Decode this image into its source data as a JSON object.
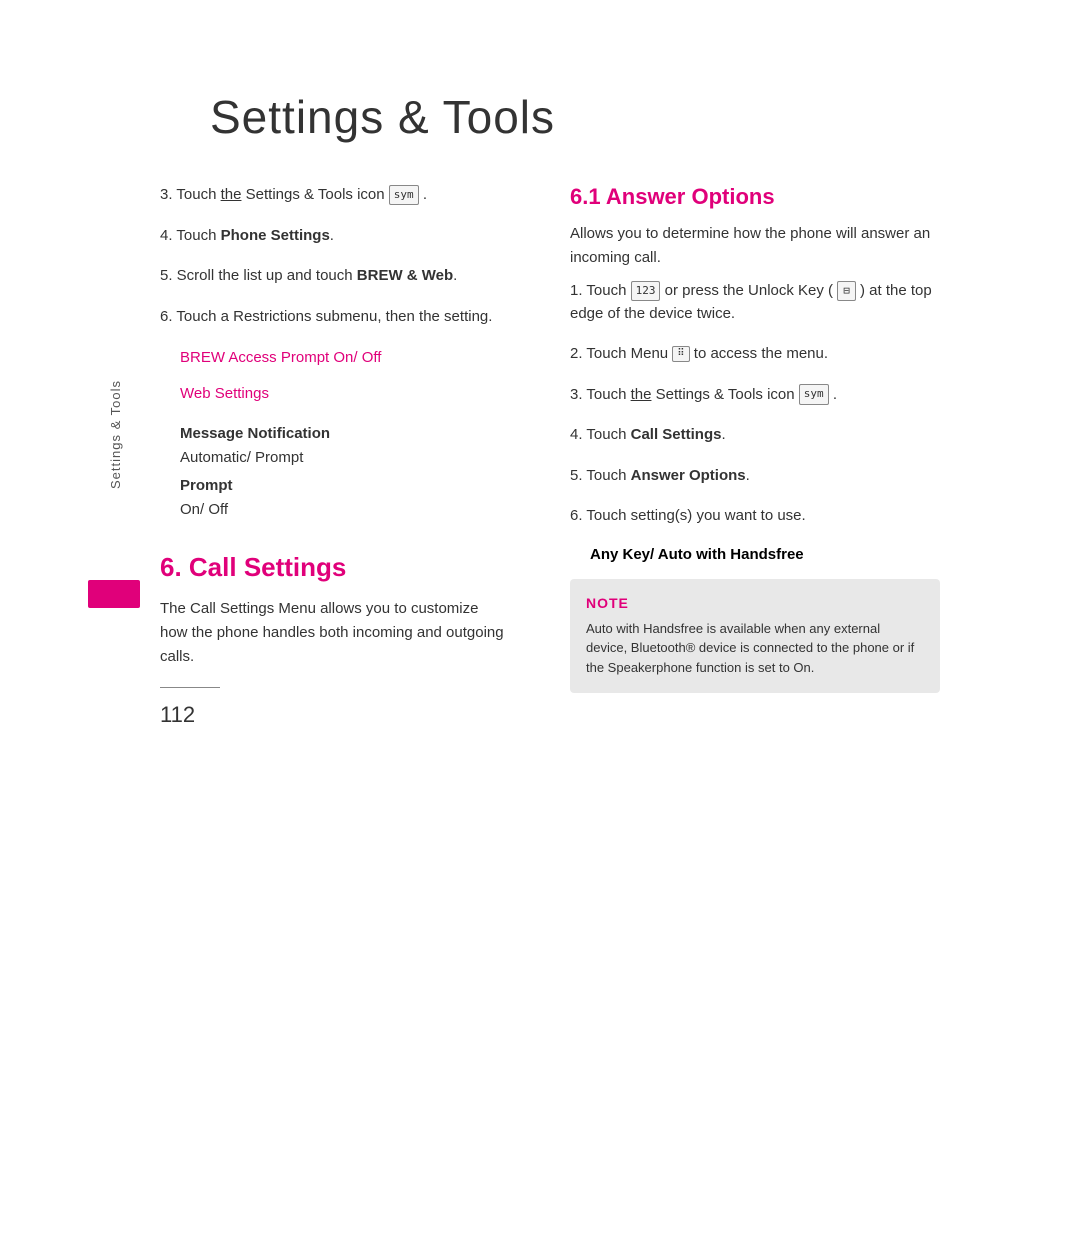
{
  "page": {
    "title": "Settings & Tools",
    "page_number": "112",
    "sidebar_label": "Settings & Tools"
  },
  "left_column": {
    "items": [
      {
        "number": "3.",
        "text_before": "Touch",
        "underline": "the",
        "text_middle": "Settings & Tools icon",
        "icon": "sym",
        "text_after": "."
      },
      {
        "number": "4.",
        "text_before": "Touch",
        "bold": "Phone Settings",
        "text_after": "."
      },
      {
        "number": "5.",
        "text_before": "Scroll the list up and touch",
        "bold": "BREW & Web",
        "text_after": "."
      },
      {
        "number": "6.",
        "text": "Touch a Restrictions submenu, then the setting."
      }
    ],
    "brew_access": "BREW Access Prompt  On/ Off",
    "web_settings": "Web Settings",
    "message_notification_label": "Message Notification",
    "message_notification_sub": "Automatic/ Prompt",
    "prompt_label": "Prompt",
    "prompt_sub": "On/ Off",
    "section_6_heading": "6. Call Settings",
    "section_6_desc": "The Call Settings Menu allows you to customize how the phone handles both incoming and outgoing calls."
  },
  "right_column": {
    "section_61_heading": "6.1 Answer Options",
    "section_61_desc": "Allows you to determine how the phone will answer an incoming call.",
    "items": [
      {
        "number": "1.",
        "text_before": "Touch",
        "icon_123": "123",
        "text_middle": "or press the Unlock Key (",
        "icon_unlock": "⊟",
        "text_after": ") at the top edge of the device twice."
      },
      {
        "number": "2.",
        "text_before": "Touch Menu",
        "icon_menu": "⠿",
        "text_after": "to access the menu."
      },
      {
        "number": "3.",
        "text_before": "Touch",
        "underline": "the",
        "text_middle": "Settings & Tools icon",
        "icon": "sym",
        "text_after": "."
      },
      {
        "number": "4.",
        "text_before": "Touch",
        "bold": "Call Settings",
        "text_after": "."
      },
      {
        "number": "5.",
        "text_before": "Touch",
        "bold": "Answer Options",
        "text_after": "."
      },
      {
        "number": "6.",
        "text": "Touch setting(s) you want to use."
      }
    ],
    "any_key_line": "Any Key/ Auto with Handsfree",
    "note_label": "NOTE",
    "note_text": "Auto with Handsfree is available when any external device, Bluetooth® device is connected to the phone or if the Speakerphone function is set to On."
  }
}
